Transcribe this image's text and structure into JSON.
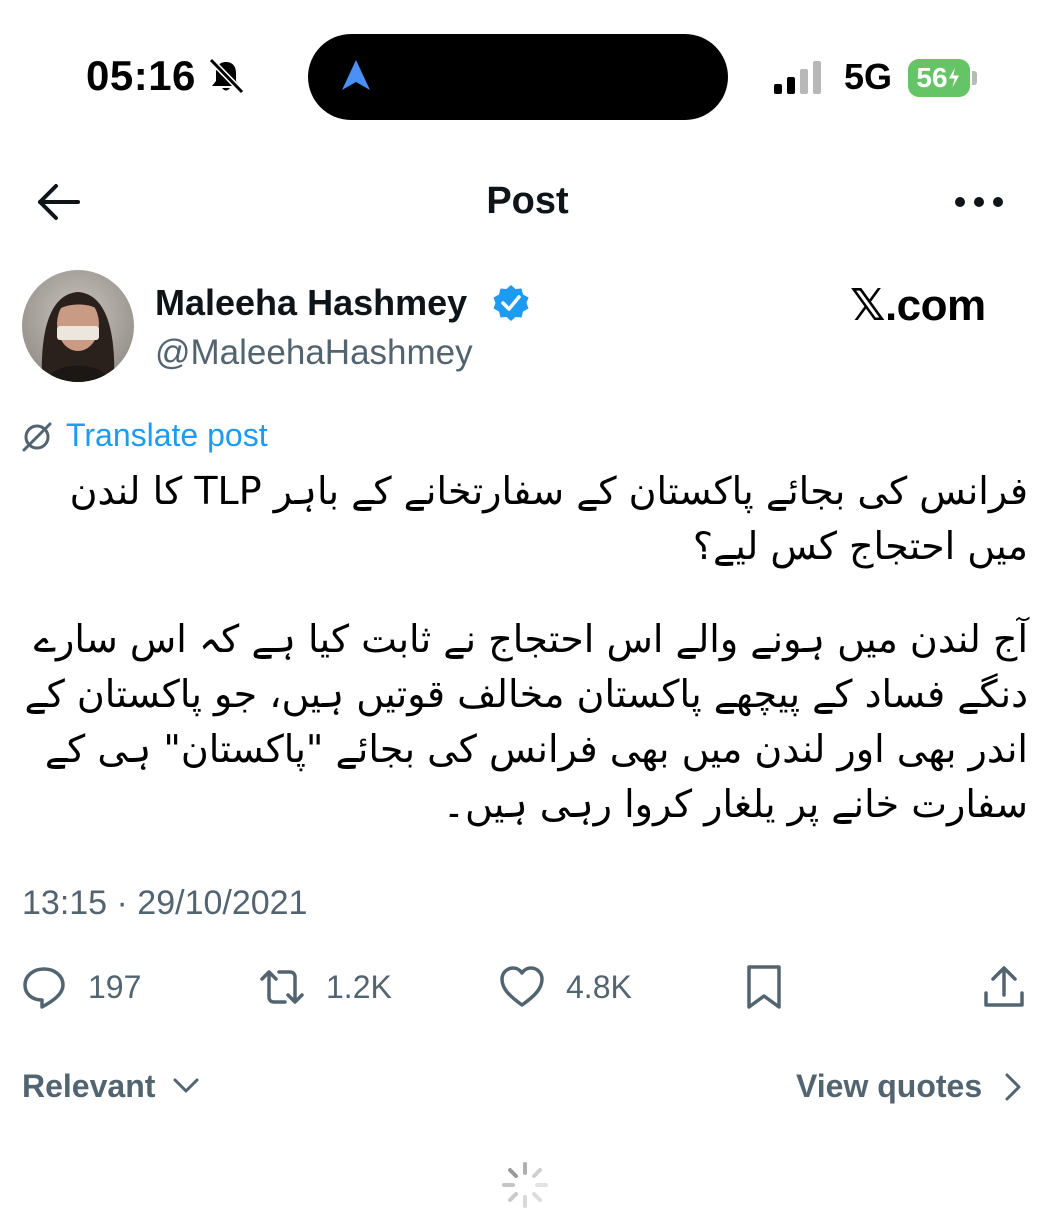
{
  "status_bar": {
    "time": "05:16",
    "network": "5G",
    "battery": "56"
  },
  "header": {
    "title": "Post"
  },
  "author": {
    "display_name": "Maleeha Hashmey",
    "handle": "@MaleehaHashmey"
  },
  "watermark": "𝕏.com",
  "translate_label": "Translate post",
  "tweet": {
    "paragraphs": [
      "فرانس کی بجائے پاکستان کے سفارتخانے کے باہر TLP کا لندن میں احتجاج کس لیے؟",
      "آج لندن میں ہونے والے اس احتجاج نے ثابت کیا ہے کہ اس سارے دنگے فساد کے پیچھے پاکستان مخالف قوتیں ہیں، جو پاکستان کے اندر بھی اور لندن میں بھی فرانس کی بجائے \"پاکستان\" ہی کے سفارت خانے پر یلغار کروا رہی ہیں۔"
    ],
    "timestamp": "13:15 · 29/10/2021"
  },
  "actions": {
    "replies": "197",
    "reposts": "1.2K",
    "likes": "4.8K"
  },
  "sort": {
    "label": "Relevant",
    "view_quotes": "View quotes"
  },
  "colors": {
    "accent": "#1d9bf0",
    "secondary_text": "#536471",
    "battery": "#65c466"
  }
}
